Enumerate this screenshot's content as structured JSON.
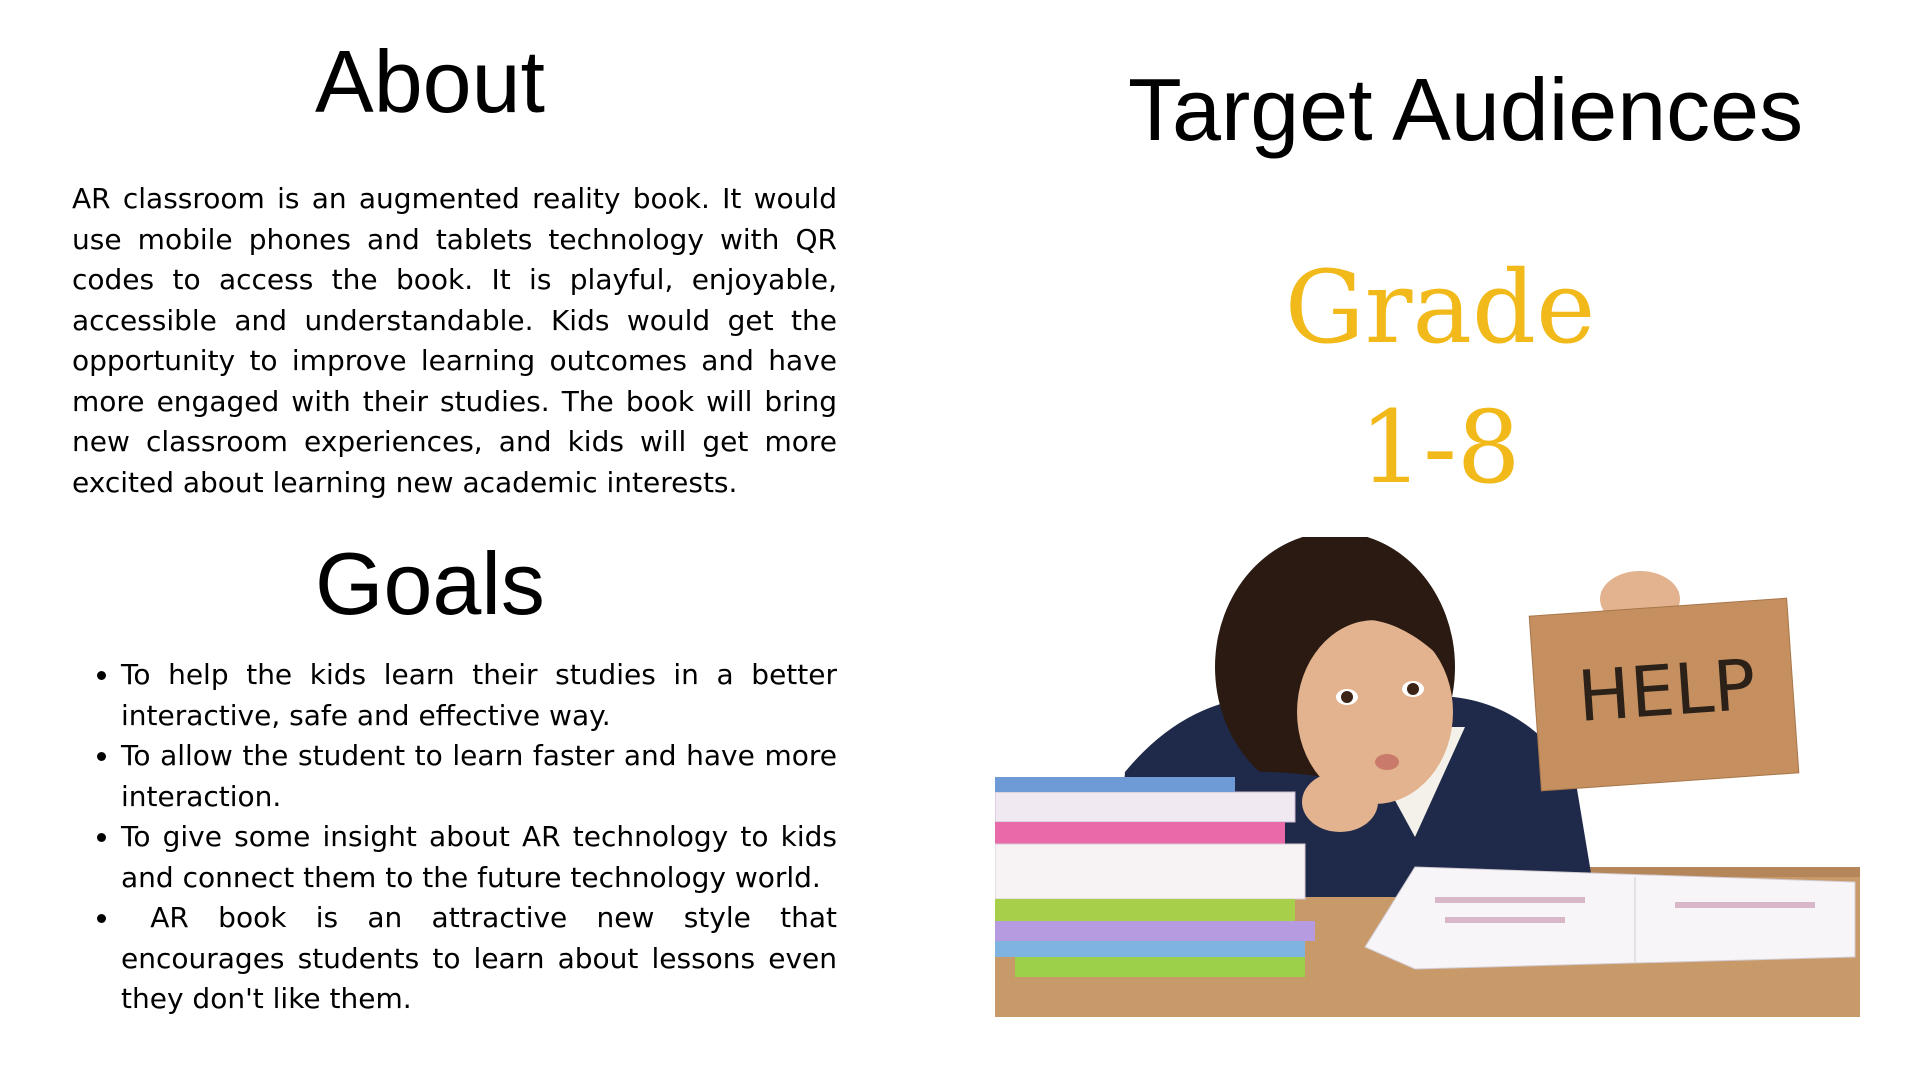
{
  "about": {
    "title": "About",
    "text": "AR classroom is an augmented reality book. It would use mobile phones and tablets technology with QR codes to access the book. It is playful, enjoyable, accessible and understandable. Kids would get the opportunity to improve learning outcomes and have more engaged with their studies. The book will bring new classroom experiences, and kids will get more excited about learning new academic interests."
  },
  "goals": {
    "title": "Goals",
    "items": [
      "To help the kids learn their studies in a better interactive, safe and effective way.",
      "To allow the student to learn faster and have more interaction.",
      "To give some insight about AR technology to kids and connect them to the future technology world.",
      " AR book is an attractive new style that encourages students to learn about lessons even they don't like them."
    ]
  },
  "audience": {
    "title": "Target Audiences",
    "grade_word": "Grade",
    "grade_range": "1-8",
    "accent_color": "#f2b91a"
  },
  "photo": {
    "sign_text": "HELP"
  }
}
